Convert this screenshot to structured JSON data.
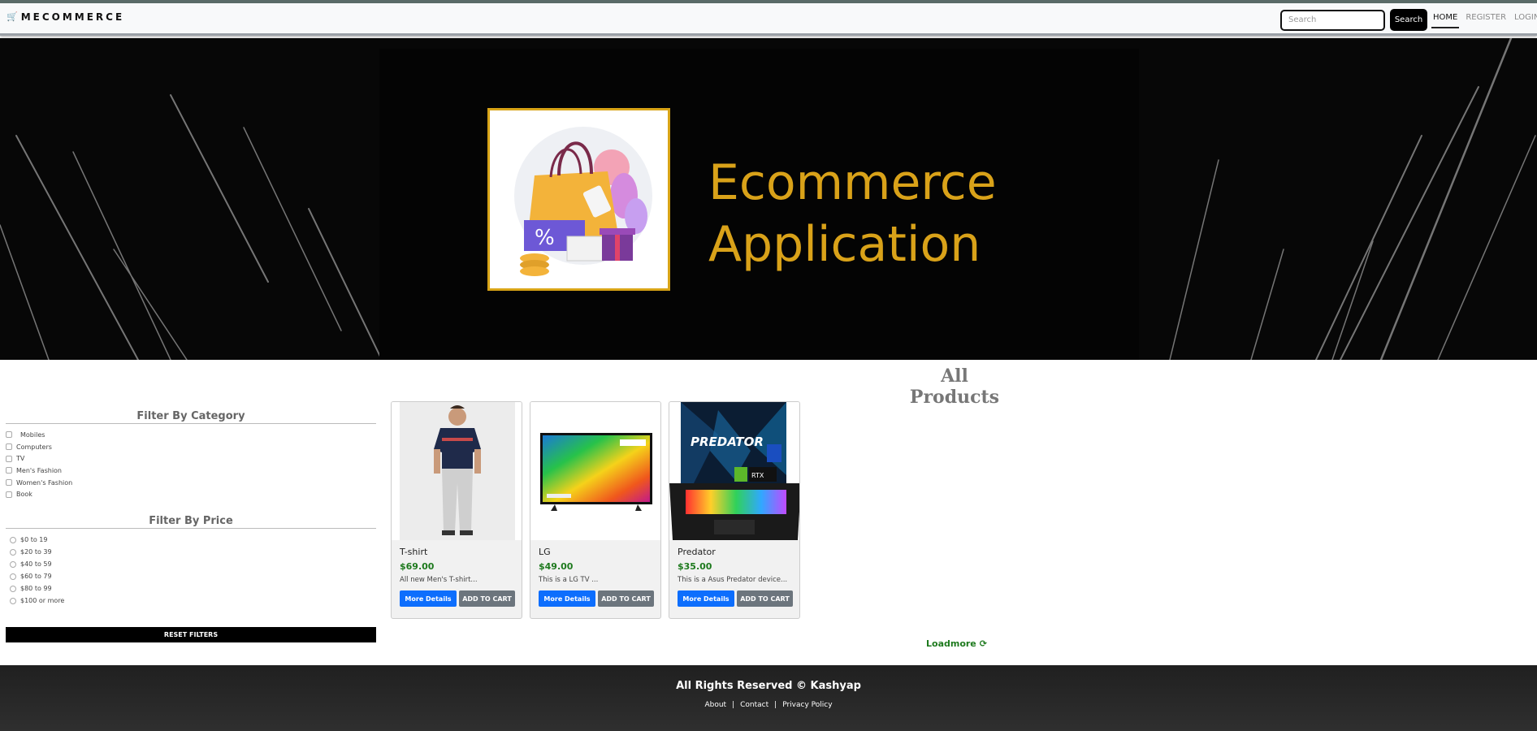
{
  "navbar": {
    "brand_icon": "cart-icon",
    "brand_label": "MECOMMERCE",
    "search_placeholder": "Search",
    "search_button": "Search",
    "links": [
      {
        "label": "HOME",
        "active": true
      },
      {
        "label": "REGISTER",
        "active": false
      },
      {
        "label": "LOGIN",
        "active": false
      }
    ]
  },
  "banner": {
    "title_line1": "Ecommerce",
    "title_line2": "Application",
    "accent_color": "#d9a219"
  },
  "main": {
    "heading": "All Products",
    "loadmore_label": "Loadmore",
    "loadmore_icon": "reload-icon"
  },
  "sidebar": {
    "category_title": "Filter By Category",
    "categories": [
      "Mobiles",
      "Computers",
      "TV",
      "Men's Fashion",
      "Women's Fashion",
      "Book"
    ],
    "price_title": "Filter By Price",
    "prices": [
      "$0 to 19",
      "$20 to 39",
      "$40 to 59",
      "$60 to 79",
      "$80 to 99",
      "$100 or more"
    ],
    "reset_label": "RESET FILTERS"
  },
  "products": [
    {
      "name": "T-shirt",
      "price": "$69.00",
      "desc": "All new Men's T-shirt...",
      "more_label": "More Details",
      "cart_label": "ADD TO CART"
    },
    {
      "name": "LG",
      "price": "$49.00",
      "desc": "This is a LG TV ...",
      "more_label": "More Details",
      "cart_label": "ADD TO CART"
    },
    {
      "name": "Predator",
      "price": "$35.00",
      "desc": "This is a Asus Predator device...",
      "more_label": "More Details",
      "cart_label": "ADD TO CART"
    }
  ],
  "footer": {
    "copyright": "All Rights Reserved © Kashyap",
    "links": [
      "About",
      "Contact",
      "Privacy Policy"
    ],
    "separator": "|"
  }
}
